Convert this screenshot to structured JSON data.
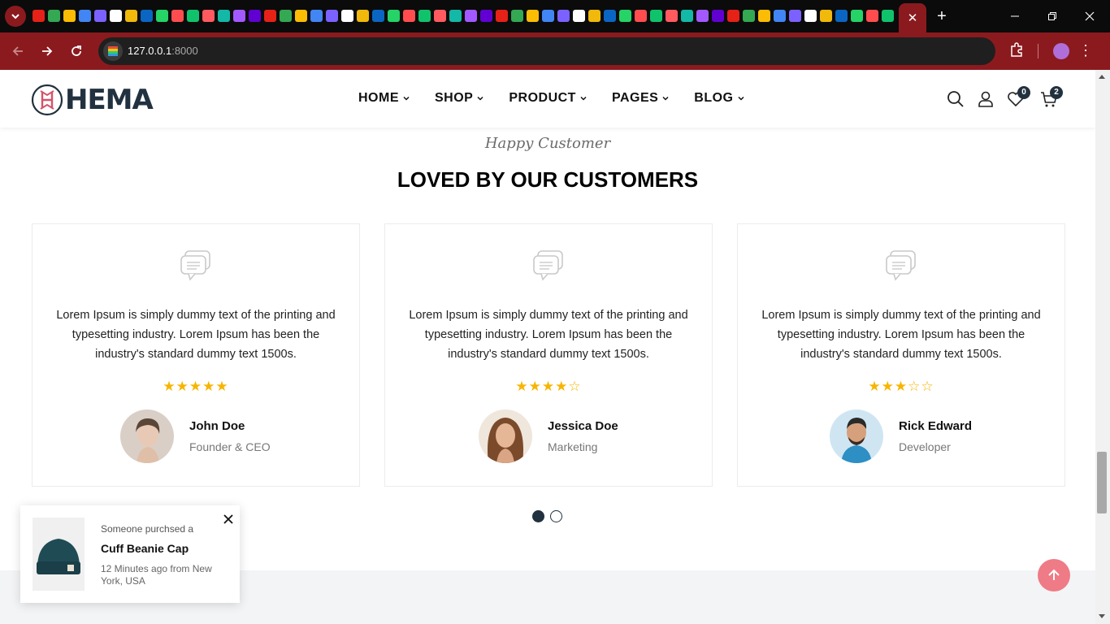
{
  "browser": {
    "url_host": "127.0.0.1",
    "url_port": ":8000",
    "active_tab_close": "✕",
    "new_tab": "+",
    "colors": {
      "chrome_red": "#8b1a1f",
      "tabstrip": "#0b0b0b"
    }
  },
  "header": {
    "logo_text": "HEMA",
    "nav": [
      {
        "label": "HOME"
      },
      {
        "label": "SHOP"
      },
      {
        "label": "PRODUCT"
      },
      {
        "label": "PAGES"
      },
      {
        "label": "BLOG"
      }
    ],
    "wishlist_count": "0",
    "cart_count": "2"
  },
  "section": {
    "eyebrow": "Happy Customer",
    "title": "LOVED BY OUR CUSTOMERS"
  },
  "testimonials": [
    {
      "text": "Lorem Ipsum is simply dummy text of the printing and typesetting industry. Lorem Ipsum has been the industry's standard dummy text 1500s.",
      "rating": 5,
      "rating_max": 5,
      "name": "John Doe",
      "role": "Founder & CEO"
    },
    {
      "text": "Lorem Ipsum is simply dummy text of the printing and typesetting industry. Lorem Ipsum has been the industry's standard dummy text 1500s.",
      "rating": 4,
      "rating_max": 5,
      "name": "Jessica Doe",
      "role": "Marketing"
    },
    {
      "text": "Lorem Ipsum is simply dummy text of the printing and typesetting industry. Lorem Ipsum has been the industry's standard dummy text 1500s.",
      "rating": 3,
      "rating_max": 5,
      "name": "Rick Edward",
      "role": "Developer"
    }
  ],
  "carousel": {
    "pages": 2,
    "active": 1
  },
  "toast": {
    "pre": "Someone purchsed a",
    "product": "Cuff Beanie Cap",
    "meta": "12 Minutes ago from New York, USA"
  },
  "colors": {
    "brand_dark": "#22313f",
    "star": "#f7b500",
    "scroll_top": "#ee7b85"
  }
}
